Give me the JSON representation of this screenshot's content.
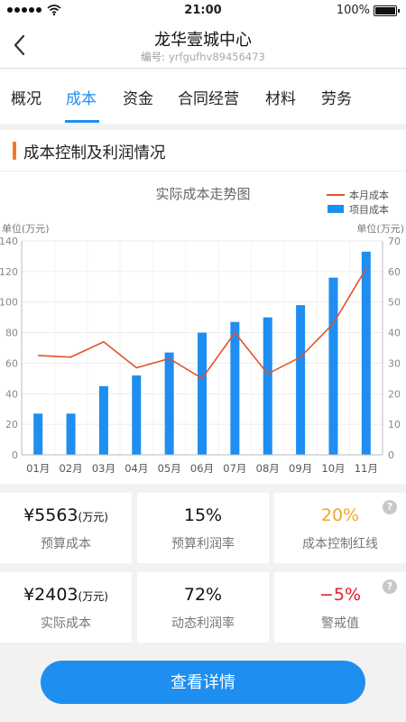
{
  "status": {
    "time": "21:00",
    "battery": "100%"
  },
  "header": {
    "title": "龙华壹城中心",
    "code_label": "编号:",
    "code": "yrfgufhv89456473"
  },
  "tabs": [
    "概况",
    "成本",
    "资金",
    "合同经营",
    "材料",
    "劳务"
  ],
  "active_tab": 1,
  "section": {
    "title": "成本控制及利润情况"
  },
  "chart_data": {
    "type": "bar",
    "title": "实际成本走势图",
    "categories": [
      "01月",
      "02月",
      "03月",
      "04月",
      "05月",
      "06月",
      "07月",
      "08月",
      "09月",
      "10月",
      "11月"
    ],
    "series": [
      {
        "name": "项目成本",
        "type": "bar",
        "axis": "left",
        "color": "#1e8ef0",
        "values": [
          27,
          27,
          45,
          52,
          67,
          80,
          87,
          90,
          98,
          116,
          133
        ]
      },
      {
        "name": "本月成本",
        "type": "line",
        "axis": "right",
        "color": "#e0542a",
        "values": [
          32.5,
          32,
          37,
          28.5,
          31.5,
          25,
          40,
          26.5,
          32,
          43,
          61
        ]
      }
    ],
    "left_axis": {
      "label": "单位(万元)",
      "ylim": [
        0,
        140
      ],
      "ticks": [
        0,
        20,
        40,
        60,
        80,
        100,
        120,
        140
      ]
    },
    "right_axis": {
      "label": "单位(万元)",
      "ylim": [
        0,
        70
      ],
      "ticks": [
        0,
        10,
        20,
        30,
        40,
        50,
        60,
        70
      ]
    },
    "legend": "top-right",
    "grid": true
  },
  "metrics": [
    {
      "value": "¥5563",
      "unit": "(万元)",
      "label": "预算成本"
    },
    {
      "value": "15%",
      "label": "预算利润率"
    },
    {
      "value": "20%",
      "label": "成本控制红线",
      "color": "#f5a623",
      "help": "?"
    },
    {
      "value": "¥2403",
      "unit": "(万元)",
      "label": "实际成本"
    },
    {
      "value": "72%",
      "label": "动态利润率"
    },
    {
      "value": "−5%",
      "label": "警戒值",
      "color": "#e8192c",
      "help": "?"
    }
  ],
  "button": {
    "label": "查看详情"
  }
}
